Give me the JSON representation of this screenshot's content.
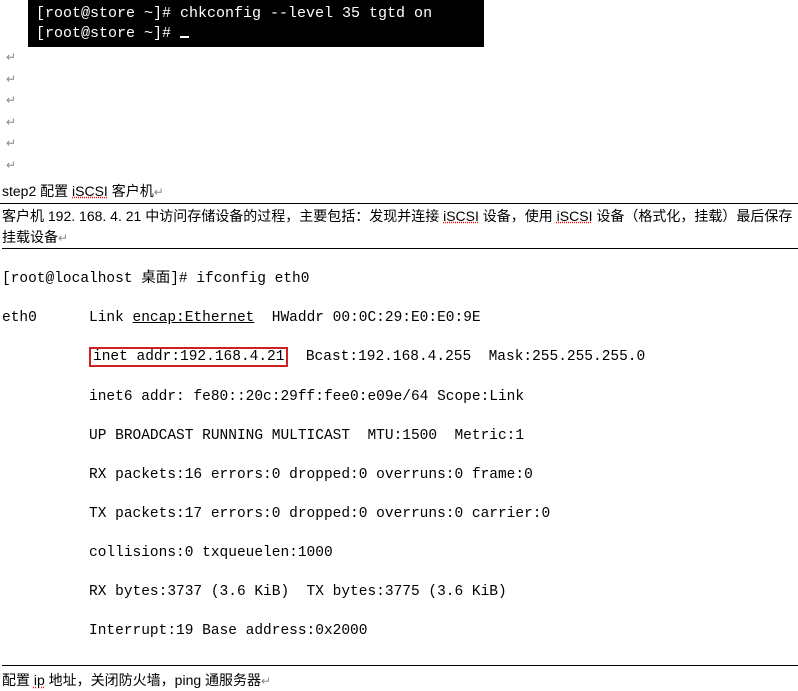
{
  "term1": {
    "line0": "[root@store ~]# chkconfig --level 35 tgtd on",
    "line1": "[root@store ~]# "
  },
  "para_mark": "↵",
  "step_label_prefix": "step2 配置 ",
  "step_label_iscsi": "iSCSI",
  "step_label_suffix": " 客户机",
  "body1_a": "客户机 192. 168. 4. 21 中访问存储设备的过程，主要包括：发现并连接 ",
  "body1_b": "iSCSI",
  "body1_c": " 设备，使用 ",
  "body1_d": "iSCSI",
  "body1_e": " 设备（格式化，挂载）最后保存挂载设备",
  "if": {
    "l0": "[root@localhost 桌面]# ifconfig eth0",
    "l1a": "eth0      Link ",
    "l1b": "encap:Ethernet",
    "l1c": "  HWaddr 00:0C:29:E0:E0:9E",
    "l2a": "          ",
    "l2b": "inet addr:192.168.4.21",
    "l2c": "  Bcast:192.168.4.255  Mask:255.255.255.0",
    "l3": "          inet6 addr: fe80::20c:29ff:fee0:e09e/64 Scope:Link",
    "l4": "          UP BROADCAST RUNNING MULTICAST  MTU:1500  Metric:1",
    "l5": "          RX packets:16 errors:0 dropped:0 overruns:0 frame:0",
    "l6": "          TX packets:17 errors:0 dropped:0 overruns:0 carrier:0",
    "l7": "          collisions:0 txqueuelen:1000",
    "l8": "          RX bytes:3737 (3.6 KiB)  TX bytes:3775 (3.6 KiB)",
    "l9": "          Interrupt:19 Base address:0x2000"
  },
  "body2_a": "配置 ",
  "body2_b": "ip",
  "body2_c": " 地址，关闭防火墙，ping 通服务器"
}
